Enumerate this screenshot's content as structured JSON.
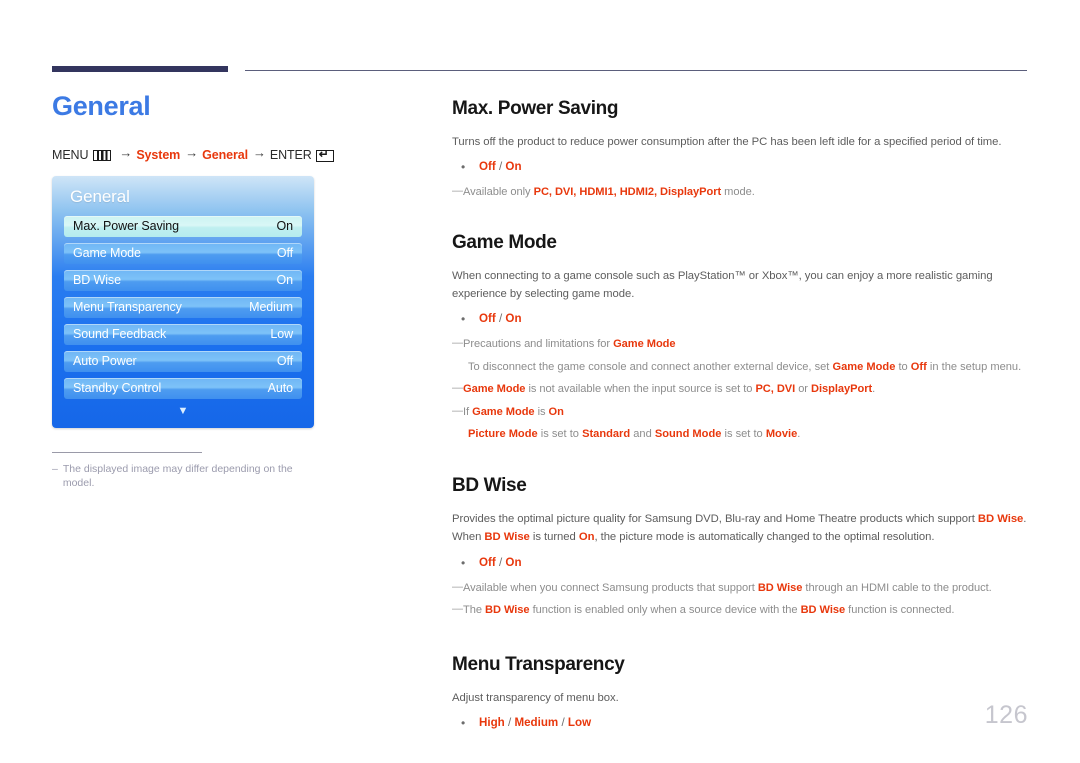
{
  "document": {
    "page_number": "126"
  },
  "left": {
    "page_title": "General",
    "breadcrumb": {
      "menu_label": "MENU",
      "menu_icon": "menu-grid-icon",
      "arrow": "→",
      "step1": "System",
      "step2": "General",
      "enter_label": "ENTER",
      "enter_icon": "enter-key-icon"
    },
    "osd": {
      "title": "General",
      "rows": [
        {
          "label": "Max. Power Saving",
          "value": "On",
          "selected": true
        },
        {
          "label": "Game Mode",
          "value": "Off",
          "selected": false
        },
        {
          "label": "BD Wise",
          "value": "On",
          "selected": false
        },
        {
          "label": "Menu Transparency",
          "value": "Medium",
          "selected": false
        },
        {
          "label": "Sound Feedback",
          "value": "Low",
          "selected": false
        },
        {
          "label": "Auto Power",
          "value": "Off",
          "selected": false
        },
        {
          "label": "Standby Control",
          "value": "Auto",
          "selected": false
        }
      ],
      "scroll_indicator": "▼"
    },
    "footnote": {
      "dash": "–",
      "text": "The displayed image may differ depending on the model."
    }
  },
  "sections": {
    "max_power_saving": {
      "title": "Max. Power Saving",
      "body": "Turns off the product to reduce power consumption after the PC has been left idle for a specified period of time.",
      "options": "Off / On",
      "note1_prefix": "Available only ",
      "note1_terms": "PC, DVI, HDMI1, HDMI2, DisplayPort",
      "note1_suffix": " mode."
    },
    "game_mode": {
      "title": "Game Mode",
      "body": "When connecting to a game console such as PlayStation™ or Xbox™, you can enjoy a more realistic gaming experience by selecting game mode.",
      "options": "Off / On",
      "note1_prefix": "Precautions and limitations for ",
      "note1_term": "Game Mode",
      "note1_sub_a": "To disconnect the game console and connect another external device, set ",
      "note1_sub_term1": "Game Mode",
      "note1_sub_b": " to ",
      "note1_sub_term2": "Off",
      "note1_sub_c": " in the setup menu.",
      "note2_term": "Game Mode",
      "note2_a": " is not available when the input source is set to ",
      "note2_term2": "PC, DVI",
      "note2_b": " or ",
      "note2_term3": "DisplayPort",
      "note2_c": ".",
      "note3_a": "If ",
      "note3_term1": "Game Mode",
      "note3_b": " is ",
      "note3_term2": "On",
      "note3_sub_term1": "Picture Mode",
      "note3_sub_a": " is set to ",
      "note3_sub_term2": "Standard",
      "note3_sub_b": " and ",
      "note3_sub_term3": "Sound Mode",
      "note3_sub_c": " is set to ",
      "note3_sub_term4": "Movie",
      "note3_sub_d": "."
    },
    "bd_wise": {
      "title": "BD Wise",
      "body_a": "Provides the optimal picture quality for Samsung DVD, Blu-ray and Home Theatre products which support ",
      "body_term1": "BD Wise",
      "body_b": ". When ",
      "body_term2": "BD Wise",
      "body_c": " is turned ",
      "body_term3": "On",
      "body_d": ", the picture mode is automatically changed to the optimal resolution.",
      "options": "Off / On",
      "note1_a": "Available when you connect Samsung products that support ",
      "note1_term": "BD Wise",
      "note1_b": " through an HDMI cable to the product.",
      "note2_a": "The ",
      "note2_term1": "BD Wise",
      "note2_b": " function is enabled only when a source device with the ",
      "note2_term2": "BD Wise",
      "note2_c": " function is connected."
    },
    "menu_transparency": {
      "title": "Menu Transparency",
      "body": "Adjust transparency of menu box.",
      "options": "High / Medium / Low"
    }
  },
  "colors": {
    "accent_blue": "#3c7ae4",
    "accent_red": "#e8380d",
    "rule_navy": "#33355e",
    "osd_blue": "#1a6fee",
    "osd_selected": "#cbf3f2"
  }
}
